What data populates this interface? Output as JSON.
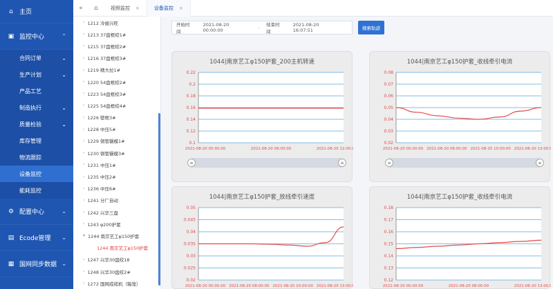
{
  "sidebar": {
    "home": "主页",
    "monitor_center": "监控中心",
    "subs": [
      {
        "label": "合同订单",
        "has_chevron": true
      },
      {
        "label": "生产计划",
        "has_chevron": true
      },
      {
        "label": "产品工艺",
        "has_chevron": false
      },
      {
        "label": "制造执行",
        "has_chevron": true
      },
      {
        "label": "质量检验",
        "has_chevron": true
      },
      {
        "label": "库存管理",
        "has_chevron": false
      },
      {
        "label": "物流跟踪",
        "has_chevron": false
      },
      {
        "label": "设备监控",
        "has_chevron": false
      },
      {
        "label": "能耗监控",
        "has_chevron": false
      }
    ],
    "config_center": "配置中心",
    "ecode": "Ecode管理",
    "sync": "国网同步数据"
  },
  "tabs": {
    "first": "视频监控",
    "second": "设备监控"
  },
  "tree": {
    "nodes": [
      "1212 冷拔兴旺",
      "1213 37盘框绞1#",
      "1215 37盘框绞2#",
      "1216 37盘框绞3#",
      "1219 精大拉1#",
      "1220 54盘框绞2#",
      "1223 54盘框绞3#",
      "1225 54盘框绞4#",
      "1226 壁框3#",
      "1228 中压5#",
      "1229 铜管辗模1#",
      "1230 铜管辗模3#",
      "1231 中压1#",
      "1235 中压2#",
      "1236 中压6#",
      "1241 分厂自动",
      "1242 兴华三盘",
      "1243 φ200护套",
      "1244 南京艺工φ150护套",
      "1244 南京艺工φ150护套",
      "1247 兴华30盘绞18",
      "1248 兴华30盘绞2#",
      "1272 国网成缆机（箱笼）"
    ]
  },
  "filter": {
    "start_label": "开始时间",
    "start_value": "2021-08-20 00:00:00",
    "end_label": "结束时间",
    "end_value": "2021-08-20 16:07:51",
    "search": "搜索轨迹"
  },
  "charts": [
    {
      "title": "1044|南京艺工φ150护套_200主机转速",
      "type": "line",
      "ylim": [
        0.1,
        0.22
      ],
      "yticks": [
        "0.22",
        "0.2",
        "0.18",
        "0.16",
        "0.14",
        "0.12",
        "0.1"
      ],
      "xticks": [
        "2021-08-20 00:00:00",
        "2021-08-20 08:00:00",
        "2021-08-20 12:00:00"
      ],
      "values": [
        0.159,
        0.159,
        0.159,
        0.159,
        0.159,
        0.159,
        0.159,
        0.159
      ],
      "line_color": "#e24a4a",
      "has_slider": true
    },
    {
      "title": "1044|南京艺工φ150护套_收线牵引电流",
      "type": "line",
      "ylim": [
        0.02,
        0.08
      ],
      "yticks": [
        "0.08",
        "0.07",
        "0.06",
        "0.05",
        "0.04",
        "0.03",
        "0.02"
      ],
      "xticks": [
        "2021-08-20 00:00:00",
        "2021-08-20 08:00:00",
        "2021-08-20 10:00:00",
        "2021-08-20 13:00:00"
      ],
      "values": [
        0.05,
        0.046,
        0.043,
        0.041,
        0.04,
        0.042,
        0.047,
        0.05
      ],
      "line_color": "#e24a4a",
      "has_slider": true
    },
    {
      "title": "1044|南京艺工φ150护套_放线牵引速度",
      "type": "line",
      "ylim": [
        0.02,
        0.05
      ],
      "yticks": [
        "0.05",
        "0.045",
        "0.04",
        "0.035",
        "0.03",
        "0.025",
        "0.02"
      ],
      "xticks": [
        "2021-08-20 00:00:00",
        "2021-08-20 08:00:00",
        "2021-08-20 10:00:00",
        "2021-08-20 13:00:00"
      ],
      "values": [
        0.035,
        0.035,
        0.035,
        0.035,
        0.0348,
        0.0345,
        0.034,
        0.0355,
        0.042
      ],
      "line_color": "#e24a4a",
      "has_slider": false
    },
    {
      "title": "1044|南京艺工φ150护套_收线牵引电流",
      "type": "line",
      "ylim": [
        0.12,
        0.18
      ],
      "yticks": [
        "0.18",
        "0.17",
        "0.16",
        "0.15",
        "0.14",
        "0.13",
        "0.12"
      ],
      "xticks": [
        "2021-08-20 00:00:00",
        "2021-08-20 08:00:00",
        "2021-08-20 13:00:00"
      ],
      "values": [
        0.146,
        0.147,
        0.148,
        0.149,
        0.15,
        0.151,
        0.152,
        0.153
      ],
      "line_color": "#e24a4a",
      "has_slider": false
    }
  ],
  "colors": {
    "sidebar": "#1f56b2",
    "accent": "#2f72d4",
    "grid": "#7fbde6",
    "line": "#e24a4a"
  }
}
